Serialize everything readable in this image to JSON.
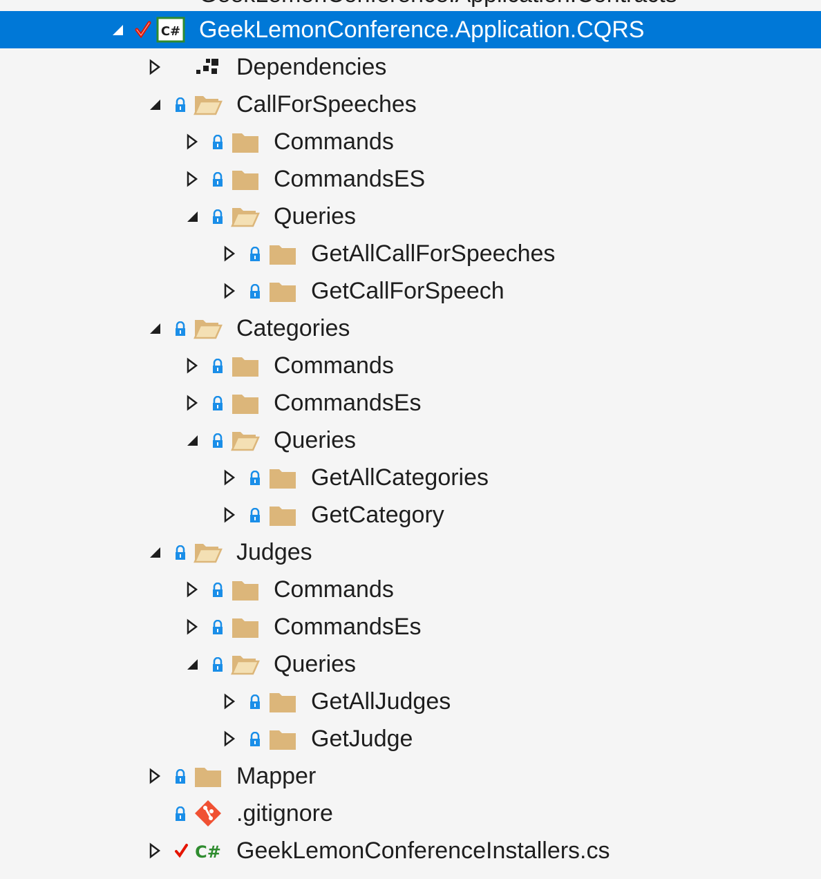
{
  "colors": {
    "selection": "#0078d7",
    "folder": "#dcb67a",
    "lock": "#1a8ee8",
    "check": "#e51400",
    "csharp": "#2f8c2f",
    "git": "#f05133"
  },
  "partial_top": {
    "label": "GeekLemonConference.Application.Contracts"
  },
  "project": {
    "label": "GeekLemonConference.Application.CQRS",
    "icon": "csharp-project-icon",
    "status": "checked-in"
  },
  "items": [
    {
      "label": "Dependencies",
      "icon": "dependencies-icon"
    },
    {
      "label": "CallForSpeeches",
      "icon": "folder-open-icon"
    },
    {
      "label": "Commands",
      "icon": "folder-icon"
    },
    {
      "label": "CommandsES",
      "icon": "folder-icon"
    },
    {
      "label": "Queries",
      "icon": "folder-open-icon"
    },
    {
      "label": "GetAllCallForSpeeches",
      "icon": "folder-icon"
    },
    {
      "label": "GetCallForSpeech",
      "icon": "folder-icon"
    },
    {
      "label": "Categories",
      "icon": "folder-open-icon"
    },
    {
      "label": "Commands",
      "icon": "folder-icon"
    },
    {
      "label": "CommandsEs",
      "icon": "folder-icon"
    },
    {
      "label": "Queries",
      "icon": "folder-open-icon"
    },
    {
      "label": "GetAllCategories",
      "icon": "folder-icon"
    },
    {
      "label": "GetCategory",
      "icon": "folder-icon"
    },
    {
      "label": "Judges",
      "icon": "folder-open-icon"
    },
    {
      "label": "Commands",
      "icon": "folder-icon"
    },
    {
      "label": "CommandsEs",
      "icon": "folder-icon"
    },
    {
      "label": "Queries",
      "icon": "folder-open-icon"
    },
    {
      "label": "GetAllJudges",
      "icon": "folder-icon"
    },
    {
      "label": "GetJudge",
      "icon": "folder-icon"
    },
    {
      "label": "Mapper",
      "icon": "folder-icon"
    },
    {
      "label": ".gitignore",
      "icon": "git-icon"
    },
    {
      "label": "GeekLemonConferenceInstallers.cs",
      "icon": "csharp-file-icon"
    }
  ]
}
